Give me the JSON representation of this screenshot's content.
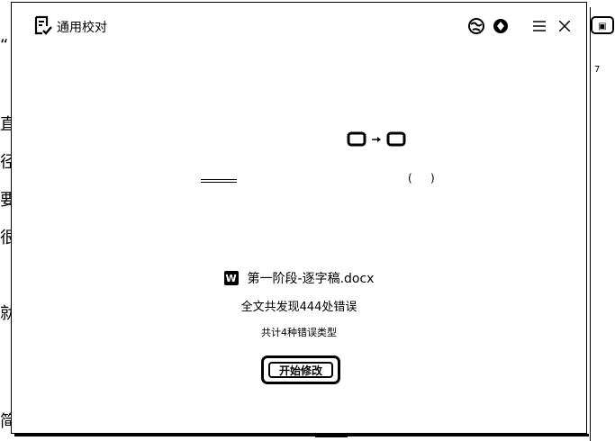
{
  "app": {
    "title": "通用校对"
  },
  "toolbar": {
    "menu_icon": "hamburger-menu-icon",
    "close_icon": "close-icon",
    "globe_icon": "globe-icon",
    "diamond_icon": "diamond-icon"
  },
  "background": {
    "left_chars": [
      "“",
      "直",
      "径",
      "要",
      "很",
      "就",
      "简"
    ],
    "right_tick": "7"
  },
  "result": {
    "file_icon_letter": "W",
    "file_name": "第一阶段-逐字稿.docx",
    "summary": "全文共发现444处错误",
    "types": "共计4种错误类型",
    "start_button": "开始修改"
  }
}
